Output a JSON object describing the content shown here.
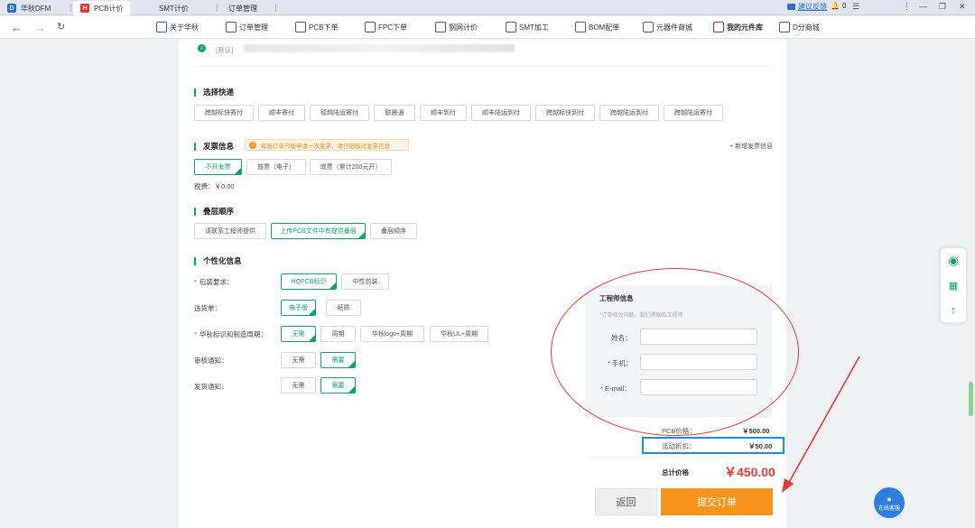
{
  "browser": {
    "tabs": [
      {
        "label": "华秋DFM"
      },
      {
        "label": "PCB计价"
      },
      {
        "label": "SMT计价"
      },
      {
        "label": "订单管理"
      }
    ],
    "feedback_label": "建议反馈",
    "notif_count": "0"
  },
  "site_nav": {
    "items": [
      "关于华秋",
      "订单管理",
      "PCB下单",
      "FPC下单",
      "钢网计价",
      "SMT加工",
      "BOM配单",
      "元器件商城",
      "我的元件库",
      "D分商城"
    ]
  },
  "address_row": {
    "tag": "[默认]"
  },
  "express": {
    "title": "选择快递",
    "options": [
      "跨越标快寄付",
      "顺丰寄付",
      "德邦陆运寄付",
      "联晨通",
      "顺丰到付",
      "顺丰陆运到付",
      "跨越标快到付",
      "跨越陆运到付",
      "跨越陆运寄付"
    ]
  },
  "invoice": {
    "title": "发票信息",
    "notice": "每张订单只能申请一次发票，请仔细核对发票信息",
    "add_link": "+ 新增发票信息",
    "options": [
      "不开发票",
      "普票（电子）",
      "增票（累计200元开）"
    ],
    "tax": "税费：￥0.00"
  },
  "stack": {
    "title": "叠层顺序",
    "options": [
      "请联系工程师提供",
      "上传PCB文件中有提供叠层",
      "叠层顺序"
    ]
  },
  "personal": {
    "title": "个性化信息",
    "rows": [
      {
        "label": "包装要求：",
        "required": true,
        "options": [
          "HQPCB标识",
          "中性包装"
        ]
      },
      {
        "label": "送货单：",
        "required": false,
        "options": [
          "电子版",
          "纸质"
        ]
      },
      {
        "label": "华秋标识和制造周期：",
        "required": true,
        "options": [
          "无需",
          "周期",
          "华秋logo+周期",
          "华秋UL+周期"
        ]
      },
      {
        "label": "审核通知：",
        "required": false,
        "options": [
          "无需",
          "需要"
        ]
      },
      {
        "label": "发货通知：",
        "required": false,
        "options": [
          "无需",
          "需要"
        ]
      }
    ]
  },
  "engineer": {
    "title": "工程师信息",
    "hint": "*订单相关问题，我们将联络工程师",
    "name_label": "姓名：",
    "phone_label": "* 手机：",
    "email_label": "* E-mail："
  },
  "price": {
    "pcb_label": "PCB价格：",
    "pcb_value": "￥500.00",
    "discount_label": "活动折扣：",
    "discount_value": "￥50.00",
    "total_label": "总计价格",
    "total_value": "￥450.00"
  },
  "actions": {
    "back": "返回",
    "submit": "提交订单"
  },
  "chat": {
    "label": "在线客服"
  },
  "colors": {
    "accent": "#12a26e",
    "submit": "#f7941d",
    "annotation_red": "#e53a3a",
    "annotation_blue": "#1c8ef0"
  }
}
